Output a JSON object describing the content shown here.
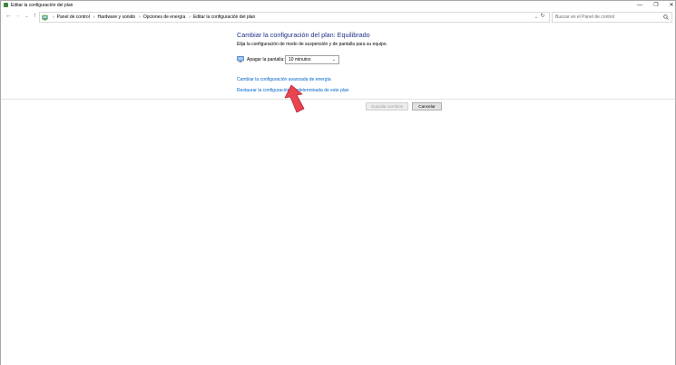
{
  "window": {
    "title": "Editar la configuración del plan",
    "controls": {
      "minimize": "—",
      "maximize": "❐",
      "close": "✕"
    }
  },
  "nav": {
    "back": "←",
    "forward": "→",
    "recent": "⌄",
    "up": "↑",
    "refresh": "↻",
    "dropdown": "⌄",
    "breadcrumbs": [
      "Panel de control",
      "Hardware y sonido",
      "Opciones de energía",
      "Editar la configuración del plan"
    ],
    "search_placeholder": "Buscar en el Panel de control"
  },
  "main": {
    "heading": "Cambiar la configuración del plan: Equilibrado",
    "subtext": "Elija la configuración de modo de suspensión y de pantalla para su equipo.",
    "screen_off_label": "Apagar la pantalla:",
    "screen_off_value": "10 minutos",
    "link_advanced": "Cambiar la configuración avanzada de energía",
    "link_restore": "Restaurar la configuración predeterminada de este plan",
    "save_button": "Guardar cambios",
    "cancel_button": "Cancelar"
  },
  "icons": {
    "app": "control-panel-icon",
    "monitor": "monitor-icon",
    "search": "search-icon",
    "pointer": "red-arrow-pointer"
  },
  "colors": {
    "heading": "#1e3287",
    "link": "#0066cc",
    "arrow": "#e84550"
  }
}
